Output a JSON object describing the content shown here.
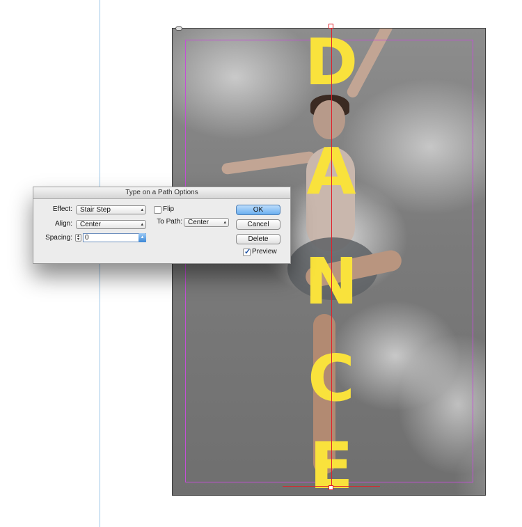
{
  "artwork": {
    "letters": [
      "D",
      "A",
      "N",
      "C",
      "E"
    ]
  },
  "dialog": {
    "title": "Type on a Path Options",
    "effect_label": "Effect:",
    "effect_value": "Stair Step",
    "align_label": "Align:",
    "align_value": "Center",
    "spacing_label": "Spacing:",
    "spacing_value": "0",
    "flip_label": "Flip",
    "flip_checked": false,
    "to_path_label": "To Path:",
    "to_path_value": "Center",
    "ok_label": "OK",
    "cancel_label": "Cancel",
    "delete_label": "Delete",
    "preview_label": "Preview",
    "preview_checked": true
  },
  "colors": {
    "letter": "#f9e23c",
    "path": "#e0202a",
    "margin_guide": "#c44ed6",
    "ruler_guide": "#9cc6e8",
    "ok_button": "#6aaff0"
  },
  "icons": {
    "select_arrows": "up-down-chevron-icon",
    "checkmark": "checkmark-icon",
    "spinner": "stepper-icon"
  }
}
